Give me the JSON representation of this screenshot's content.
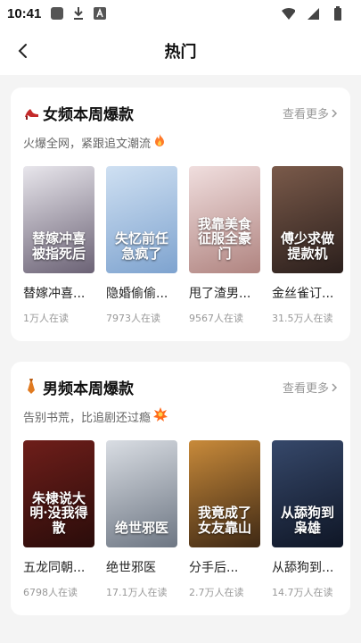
{
  "status": {
    "time": "10:41"
  },
  "nav": {
    "title": "热门",
    "icons": {
      "back": "chevron-left-icon"
    }
  },
  "colors": {
    "accent_orange": "#ff7a2a",
    "muted": "#999999",
    "card_bg": "#ffffff",
    "page_bg": "#f4f4f4"
  },
  "sections": [
    {
      "title": "女频本周爆款",
      "icon": "high-heel-icon",
      "more": "查看更多",
      "subtitle": "火爆全网，紧跟追文潮流",
      "subtitle_icon": "fire-icon",
      "books": [
        {
          "name": "替嫁冲喜...",
          "readers": "1万人在读",
          "cover_text": "替嫁冲喜被指死后",
          "cover_colors": [
            "#e8e6ec",
            "#6b6275"
          ]
        },
        {
          "name": "隐婚偷偷...",
          "readers": "7973人在读",
          "cover_text": "失忆前任急疯了",
          "cover_colors": [
            "#cfe0f2",
            "#7ea3cf"
          ]
        },
        {
          "name": "甩了渣男...",
          "readers": "9567人在读",
          "cover_text": "我靠美食征服全豪门",
          "cover_colors": [
            "#f0dede",
            "#b08480"
          ]
        },
        {
          "name": "金丝雀订...",
          "readers": "31.5万人在读",
          "cover_text": "傅少求做提款机",
          "cover_colors": [
            "#7a5a4a",
            "#2b1f1c"
          ]
        }
      ]
    },
    {
      "title": "男频本周爆款",
      "icon": "tie-icon",
      "more": "查看更多",
      "subtitle": "告别书荒，比追剧还过瘾",
      "subtitle_icon": "burst-icon",
      "books": [
        {
          "name": "五龙同朝...",
          "readers": "6798人在读",
          "cover_text": "朱棣说大明·没我得散",
          "cover_colors": [
            "#6e1e1a",
            "#2a0c0a"
          ]
        },
        {
          "name": "绝世邪医",
          "readers": "17.1万人在读",
          "cover_text": "绝世邪医",
          "cover_colors": [
            "#d9dde3",
            "#6d7683"
          ]
        },
        {
          "name": "分手后...",
          "readers": "2.7万人在读",
          "cover_text": "我竟成了女友靠山",
          "cover_colors": [
            "#c88a3a",
            "#3e2814"
          ]
        },
        {
          "name": "从舔狗到...",
          "readers": "14.7万人在读",
          "cover_text": "从舔狗到枭雄",
          "cover_colors": [
            "#36486a",
            "#0f1626"
          ]
        }
      ]
    }
  ]
}
